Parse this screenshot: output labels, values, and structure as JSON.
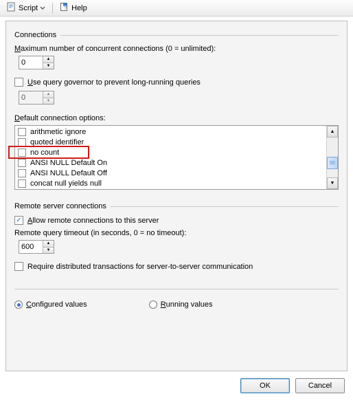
{
  "toolbar": {
    "script_label": "Script",
    "help_label": "Help"
  },
  "connections": {
    "group_title": "Connections",
    "max_label_pre": "M",
    "max_label_post": "aximum number of concurrent connections (0 = unlimited):",
    "max_value": "0",
    "governor_pre": "U",
    "governor_post": "se query governor to prevent long-running queries",
    "governor_checked": false,
    "governor_value": "0",
    "default_opts_pre": "D",
    "default_opts_post": "efault connection options:",
    "options": [
      {
        "label": "arithmetic ignore",
        "checked": false
      },
      {
        "label": "quoted identifier",
        "checked": false
      },
      {
        "label": "no count",
        "checked": false
      },
      {
        "label": "ANSI NULL Default On",
        "checked": false
      },
      {
        "label": "ANSI NULL Default Off",
        "checked": false
      },
      {
        "label": "concat null yields null",
        "checked": false
      }
    ]
  },
  "remote": {
    "group_title": "Remote server connections",
    "allow_pre": "A",
    "allow_post": "llow remote connections to this server",
    "allow_checked": true,
    "timeout_label": "Remote query timeout (in seconds, 0 = no timeout):",
    "timeout_value": "600",
    "dtc_label": "Require distributed transactions for server-to-server communication",
    "dtc_checked": false
  },
  "radios": {
    "configured_pre": "C",
    "configured_post": "onfigured values",
    "running_pre": "R",
    "running_post": "unning values",
    "selected": "configured"
  },
  "footer": {
    "ok": "OK",
    "cancel": "Cancel"
  }
}
